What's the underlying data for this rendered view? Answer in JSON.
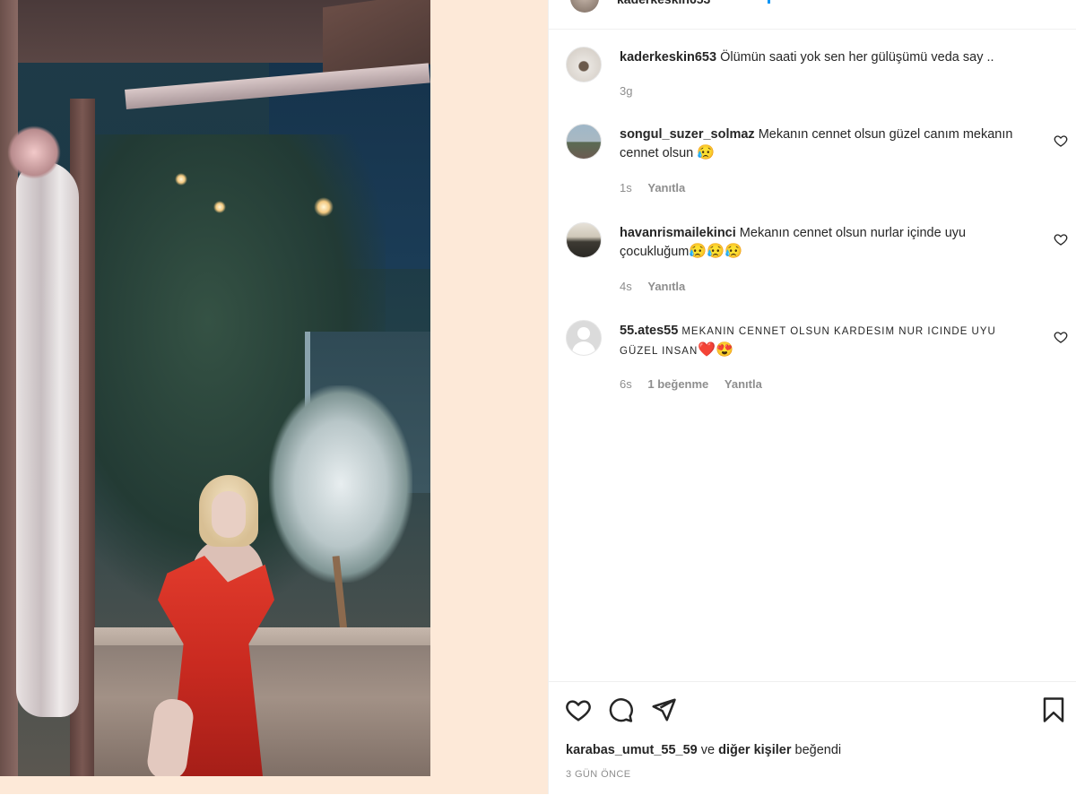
{
  "post": {
    "author": "kaderkeskin653",
    "caption_user": "kaderkeskin653",
    "caption_text": "Ölümün saati yok sen her gülüşümü veda say ..",
    "caption_time": "3g"
  },
  "comments": [
    {
      "user": "songul_suzer_solmaz",
      "text": "Mekanın cennet olsun güzel canım mekanın cennet olsun",
      "emoji": "😥",
      "time": "1s",
      "reply_label": "Yanıtla"
    },
    {
      "user": "havanrismailekinci",
      "text": "Mekanın cennet olsun nurlar içinde uyu çocukluğum",
      "emoji": "😥😥😥",
      "time": "4s",
      "reply_label": "Yanıtla"
    },
    {
      "user": "55.ates55",
      "text": "MEKANIN CENNET OLSUN KARDESIM NUR ICINDE UYU GÜZEL INSAN",
      "emoji": "❤️😍",
      "time": "6s",
      "likes_label": "1 beğenme",
      "reply_label": "Yanıtla"
    }
  ],
  "likes": {
    "first_user": "karabas_umut_55_59",
    "connector": "ve",
    "others": "diğer kişiler",
    "suffix": "beğendi"
  },
  "date": "3 GÜN ÖNCE",
  "icons": [
    "heart-icon",
    "comment-icon",
    "share-icon",
    "bookmark-icon"
  ],
  "colors": {
    "link_blue": "#0095f6",
    "muted": "#8e8e8e",
    "text": "#262626",
    "backdrop": "#fde9d8"
  }
}
